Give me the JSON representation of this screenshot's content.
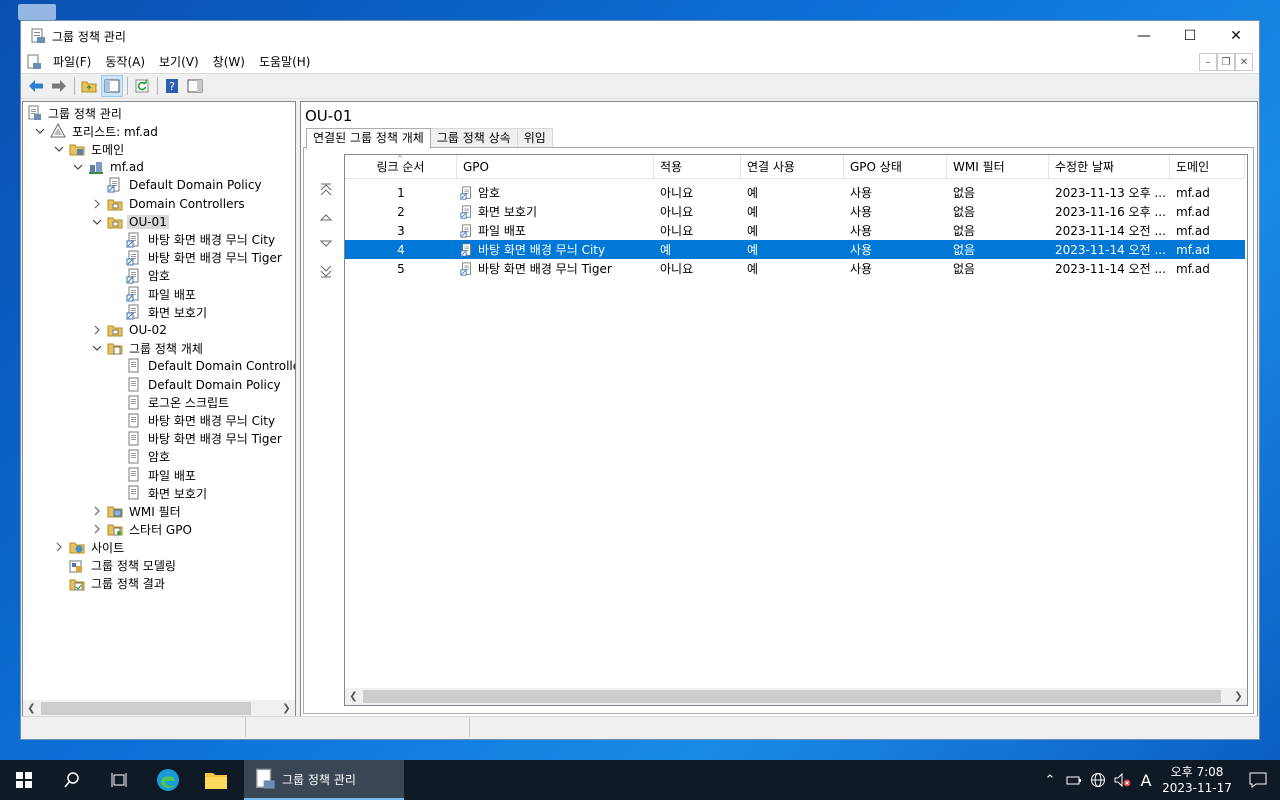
{
  "window": {
    "title": "그룹 정책 관리"
  },
  "menu": [
    "파일(F)",
    "동작(A)",
    "보기(V)",
    "창(W)",
    "도움말(H)"
  ],
  "tree": [
    {
      "label": "그룹 정책 관리",
      "indent": 0,
      "twisty": "",
      "icon": "gpm-icon"
    },
    {
      "label": "포리스트: mf.ad",
      "indent": 1,
      "twisty": "v",
      "icon": "forest-icon"
    },
    {
      "label": "도메인",
      "indent": 2,
      "twisty": "v",
      "icon": "domains-folder-icon"
    },
    {
      "label": "mf.ad",
      "indent": 3,
      "twisty": "v",
      "icon": "domain-icon"
    },
    {
      "label": "Default Domain Policy",
      "indent": 4,
      "twisty": "",
      "icon": "gpo-link-icon"
    },
    {
      "label": "Domain Controllers",
      "indent": 4,
      "twisty": ">",
      "icon": "ou-icon"
    },
    {
      "label": "OU-01",
      "indent": 4,
      "twisty": "v",
      "icon": "ou-icon",
      "selected": true
    },
    {
      "label": "바탕 화면 배경 무늬 City",
      "indent": 5,
      "twisty": "",
      "icon": "gpo-link-icon"
    },
    {
      "label": "바탕 화면 배경 무늬 Tiger",
      "indent": 5,
      "twisty": "",
      "icon": "gpo-link-icon"
    },
    {
      "label": "암호",
      "indent": 5,
      "twisty": "",
      "icon": "gpo-link-icon"
    },
    {
      "label": "파일 배포",
      "indent": 5,
      "twisty": "",
      "icon": "gpo-link-icon"
    },
    {
      "label": "화면 보호기",
      "indent": 5,
      "twisty": "",
      "icon": "gpo-link-icon"
    },
    {
      "label": "OU-02",
      "indent": 4,
      "twisty": ">",
      "icon": "ou-icon"
    },
    {
      "label": "그룹 정책 개체",
      "indent": 4,
      "twisty": "v",
      "icon": "gpo-folder-icon"
    },
    {
      "label": "Default Domain Controllers",
      "indent": 5,
      "twisty": "",
      "icon": "gpo-icon"
    },
    {
      "label": "Default Domain Policy",
      "indent": 5,
      "twisty": "",
      "icon": "gpo-icon"
    },
    {
      "label": "로그온 스크립트",
      "indent": 5,
      "twisty": "",
      "icon": "gpo-icon"
    },
    {
      "label": "바탕 화면 배경 무늬 City",
      "indent": 5,
      "twisty": "",
      "icon": "gpo-icon"
    },
    {
      "label": "바탕 화면 배경 무늬 Tiger",
      "indent": 5,
      "twisty": "",
      "icon": "gpo-icon"
    },
    {
      "label": "암호",
      "indent": 5,
      "twisty": "",
      "icon": "gpo-icon"
    },
    {
      "label": "파일 배포",
      "indent": 5,
      "twisty": "",
      "icon": "gpo-icon"
    },
    {
      "label": "화면 보호기",
      "indent": 5,
      "twisty": "",
      "icon": "gpo-icon"
    },
    {
      "label": "WMI 필터",
      "indent": 4,
      "twisty": ">",
      "icon": "wmi-folder-icon"
    },
    {
      "label": "스타터 GPO",
      "indent": 4,
      "twisty": ">",
      "icon": "starter-gpo-folder-icon"
    },
    {
      "label": "사이트",
      "indent": 2,
      "twisty": ">",
      "icon": "sites-icon"
    },
    {
      "label": "그룹 정책 모델링",
      "indent": 2,
      "twisty": "",
      "icon": "modeling-icon"
    },
    {
      "label": "그룹 정책 결과",
      "indent": 2,
      "twisty": "",
      "icon": "results-icon"
    }
  ],
  "right": {
    "title": "OU-01",
    "tabs": [
      "연결된 그룹 정책 개체",
      "그룹 정책 상속",
      "위임"
    ],
    "columns": [
      "링크 순서",
      "GPO",
      "적용",
      "연결 사용",
      "GPO 상태",
      "WMI 필터",
      "수정한 날짜",
      "도메인"
    ],
    "rows": [
      [
        "1",
        "암호",
        "아니요",
        "예",
        "사용",
        "없음",
        "2023-11-13 오후 ...",
        "mf.ad"
      ],
      [
        "2",
        "화면 보호기",
        "아니요",
        "예",
        "사용",
        "없음",
        "2023-11-16 오후 ...",
        "mf.ad"
      ],
      [
        "3",
        "파일 배포",
        "아니요",
        "예",
        "사용",
        "없음",
        "2023-11-14 오전 ...",
        "mf.ad"
      ],
      [
        "4",
        "바탕 화면 배경 무늬 City",
        "예",
        "예",
        "사용",
        "없음",
        "2023-11-14 오전 ...",
        "mf.ad"
      ],
      [
        "5",
        "바탕 화면 배경 무늬 Tiger",
        "아니요",
        "예",
        "사용",
        "없음",
        "2023-11-14 오전 ...",
        "mf.ad"
      ]
    ],
    "selected_row": 3
  },
  "taskbar": {
    "app_label": "그룹 정책 관리",
    "clock_time": "오후 7:08",
    "clock_date": "2023-11-17",
    "ime": "A"
  },
  "colors": {
    "selection": "#0078d7",
    "taskbar": "#101a25",
    "desktop": "#0b6fd6"
  }
}
